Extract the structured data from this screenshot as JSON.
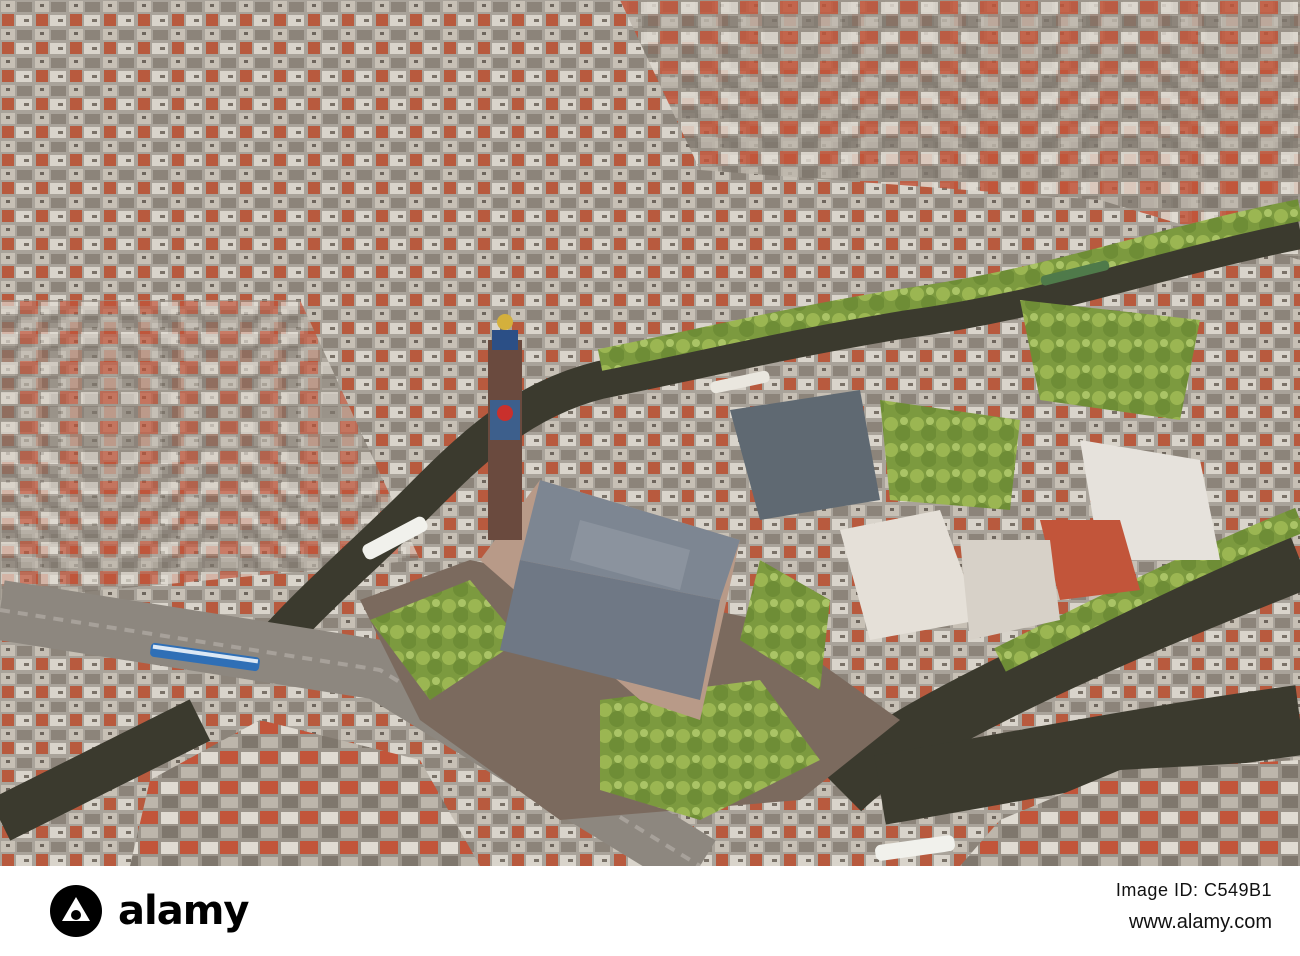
{
  "photo": {
    "subject": "aerial-cityscape",
    "icon": "aerial-city-photo"
  },
  "watermark": {
    "brand": "alamy",
    "image_id": "Image ID: C549B1",
    "site": "www.alamy.com"
  }
}
